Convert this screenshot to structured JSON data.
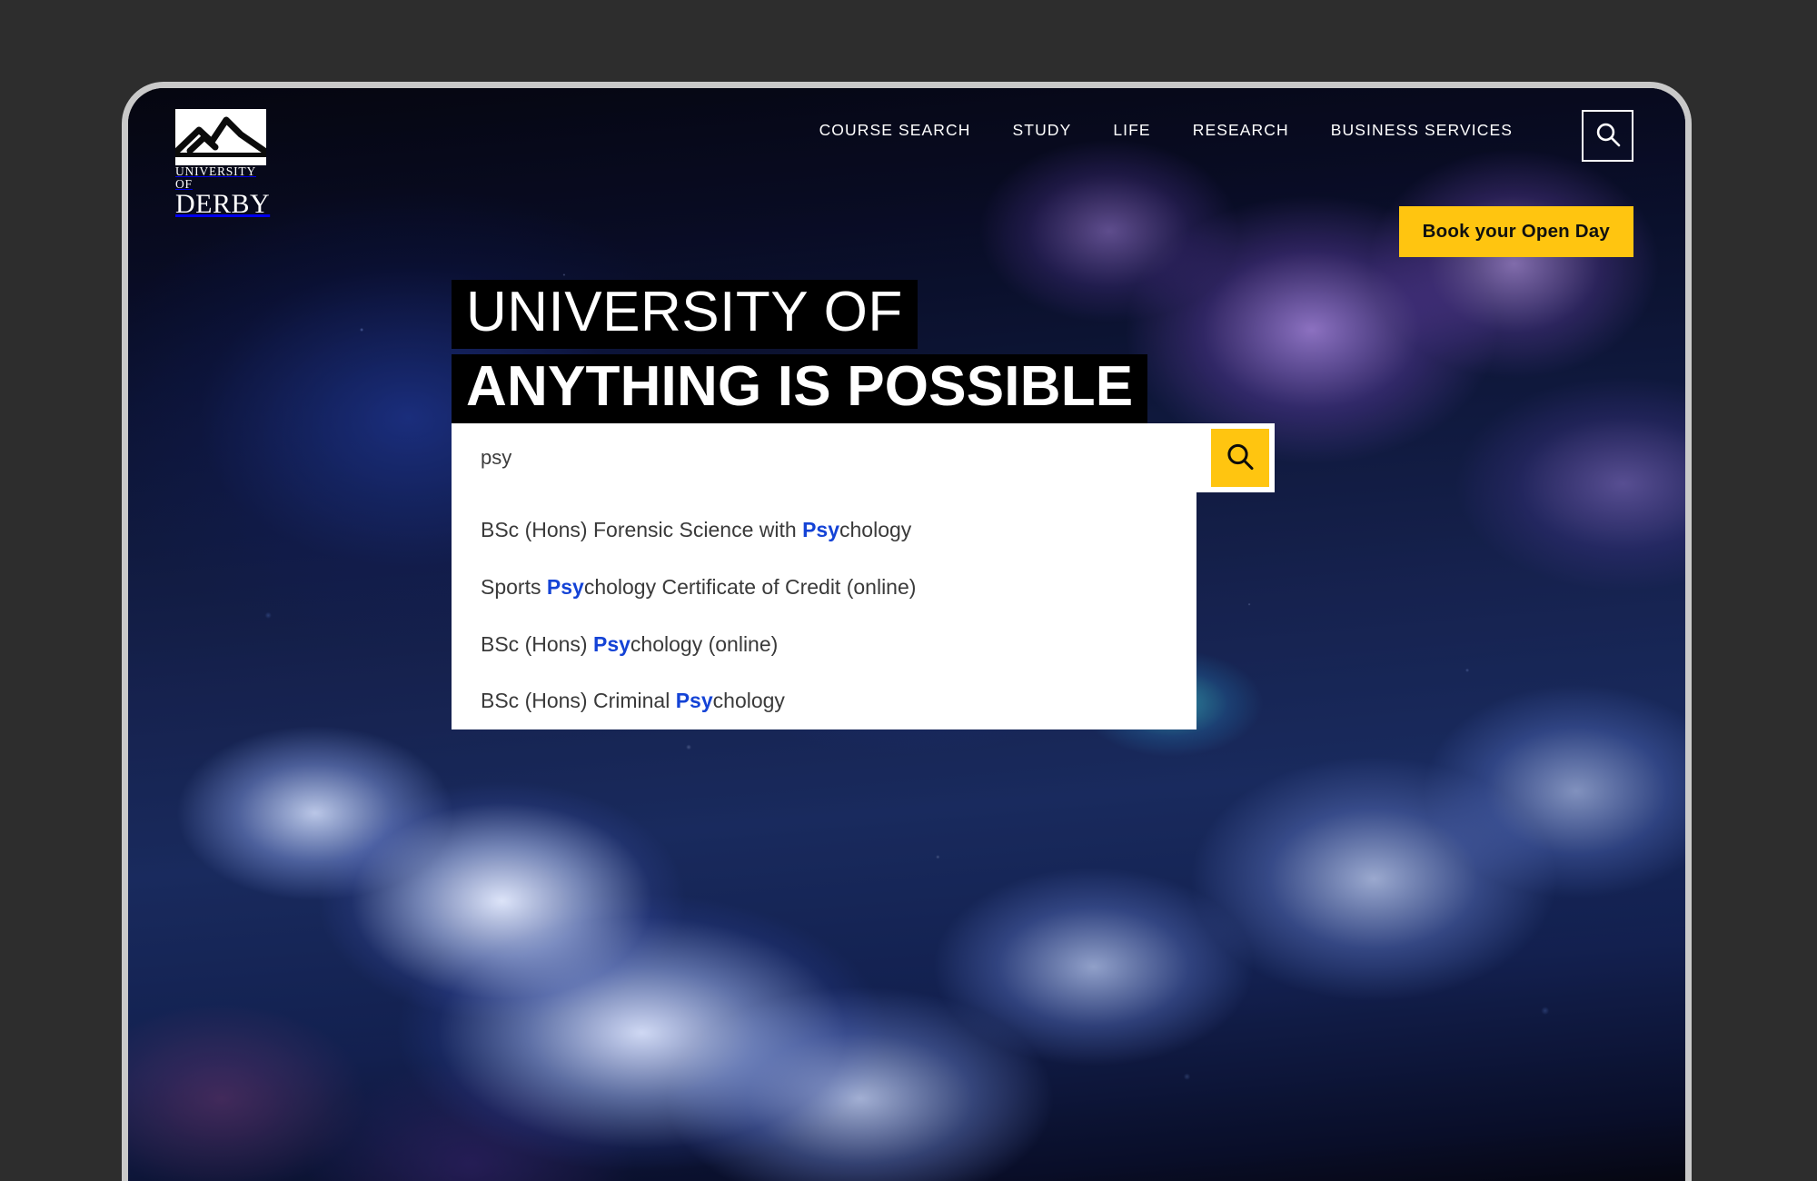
{
  "brand": {
    "logo_line1": "UNIVERSITY OF",
    "logo_line2": "DERBY",
    "logo_icon": "mountains-logo-icon",
    "accent_color": "#ffc510",
    "link_color": "#1443d6"
  },
  "nav": {
    "items": [
      {
        "label": "COURSE SEARCH"
      },
      {
        "label": "STUDY"
      },
      {
        "label": "LIFE"
      },
      {
        "label": "RESEARCH"
      },
      {
        "label": "BUSINESS SERVICES"
      }
    ],
    "search_icon": "search-icon"
  },
  "cta": {
    "open_day_label": "Book your Open Day"
  },
  "hero": {
    "line1": "UNIVERSITY OF",
    "line2": "ANYTHING IS POSSIBLE"
  },
  "search": {
    "value": "psy",
    "placeholder": "",
    "submit_icon": "search-icon",
    "suggestions": [
      {
        "prefix": "BSc (Hons) Forensic Science with ",
        "match": "Psy",
        "suffix": "chology"
      },
      {
        "prefix": "Sports ",
        "match": "Psy",
        "suffix": "chology Certificate of Credit (online)"
      },
      {
        "prefix": "BSc (Hons) ",
        "match": "Psy",
        "suffix": "chology (online)"
      },
      {
        "prefix": "BSc (Hons) Criminal ",
        "match": "Psy",
        "suffix": "chology"
      }
    ]
  }
}
